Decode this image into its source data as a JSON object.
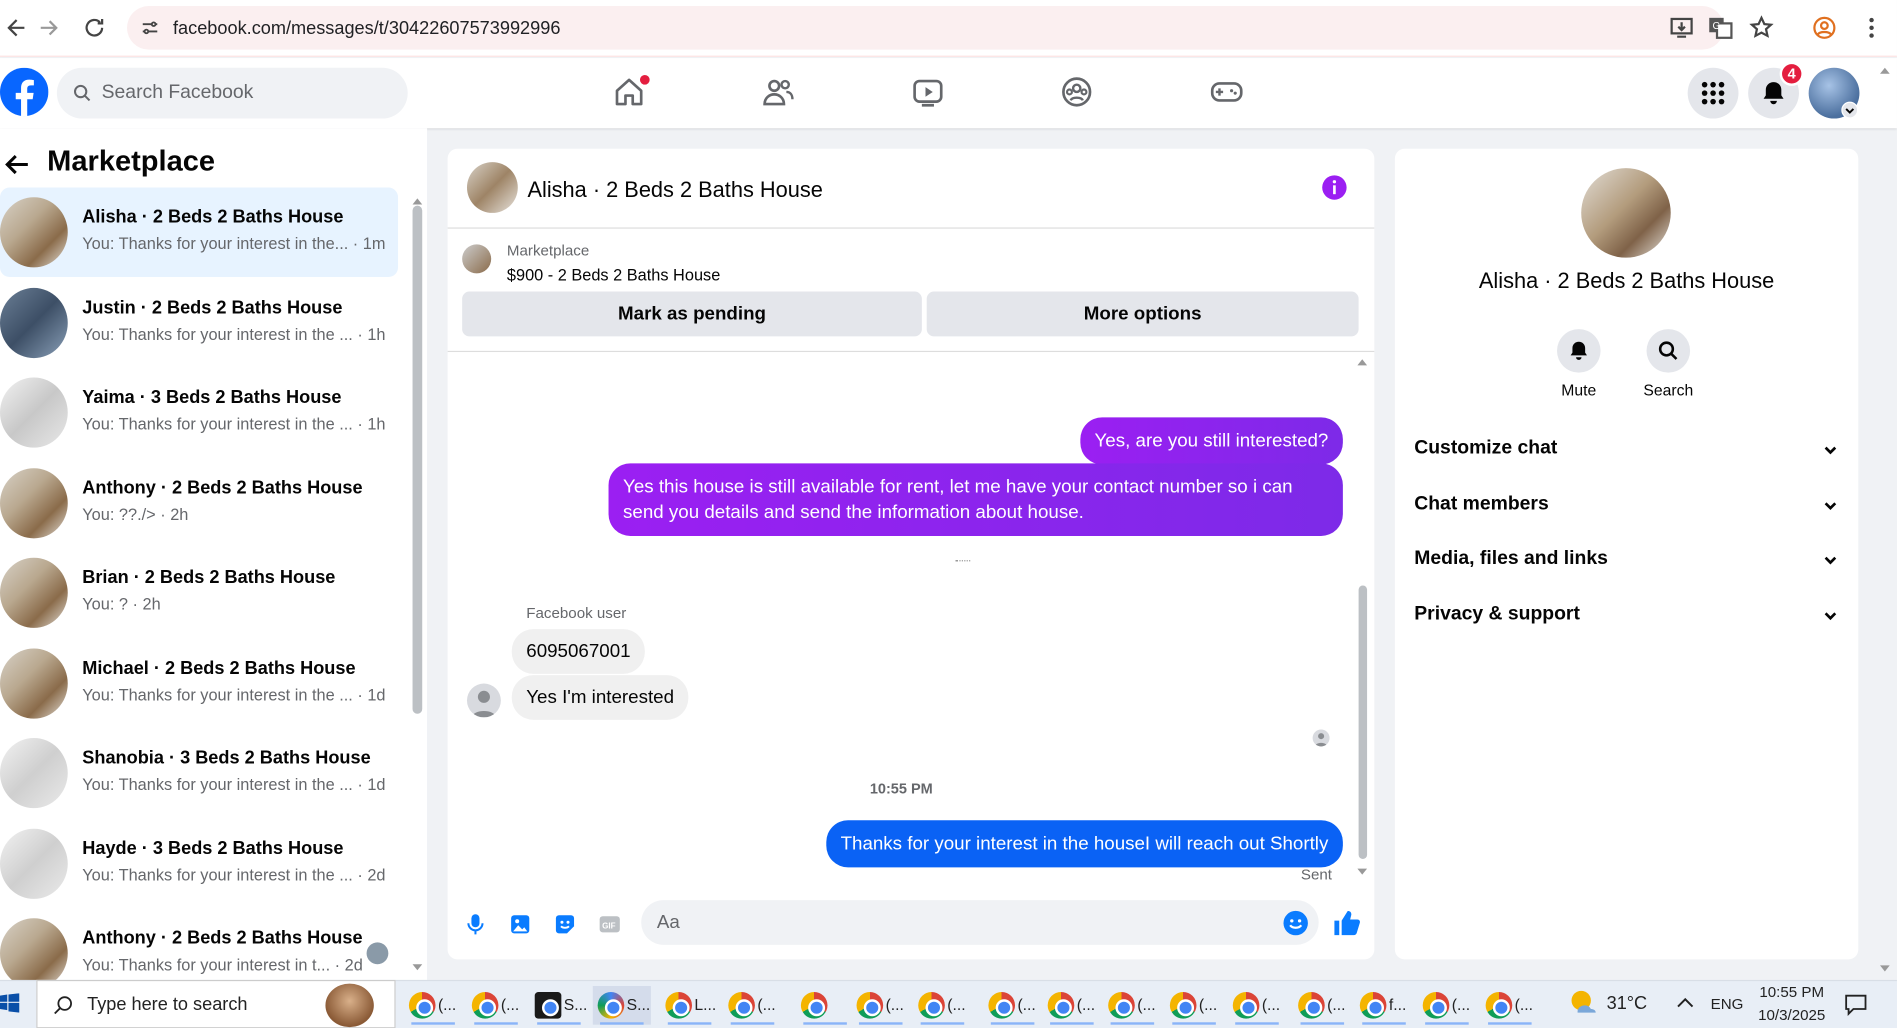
{
  "browser": {
    "url": "facebook.com/messages/t/30422607573992996"
  },
  "header": {
    "search_placeholder": "Search Facebook",
    "notification_count": "4",
    "nav_icons": [
      "home-icon",
      "friends-icon",
      "watch-icon",
      "groups-icon",
      "gaming-icon"
    ]
  },
  "sidebar": {
    "title": "Marketplace",
    "conversations": [
      {
        "name": "Alisha · 2 Beds 2 Baths House",
        "preview": "You: Thanks for your interest in the... · 1m"
      },
      {
        "name": "Justin · 2 Beds 2 Baths House",
        "preview": "You: Thanks for your interest in the ... · 1h"
      },
      {
        "name": "Yaima · 3 Beds 2 Baths House",
        "preview": "You: Thanks for your interest in the ... · 1h"
      },
      {
        "name": "Anthony · 2 Beds 2 Baths House",
        "preview": "You: ??./> · 2h"
      },
      {
        "name": "Brian · 2 Beds 2 Baths House",
        "preview": "You: ? · 2h"
      },
      {
        "name": "Michael · 2 Beds 2 Baths House",
        "preview": "You: Thanks for your interest in the ... · 1d"
      },
      {
        "name": "Shanobia · 3 Beds 2 Baths House",
        "preview": "You: Thanks for your interest in the ... · 1d"
      },
      {
        "name": "Hayde · 3 Beds 2 Baths House",
        "preview": "You: Thanks for your interest in the ... · 2d"
      },
      {
        "name": "Anthony · 2 Beds 2 Baths House",
        "preview": "You: Thanks for your interest in t... · 2d"
      }
    ]
  },
  "chat": {
    "title": "Alisha · 2 Beds 2 Baths House",
    "listing_category": "Marketplace",
    "listing_title": "$900 - 2 Beds 2 Baths House",
    "mark_pending": "Mark as pending",
    "more_options": "More options",
    "msg_out_1": "Yes, are you still interested?",
    "msg_out_2": "Yes this house is still available for rent, let me have your contact number so i can send you details and send the information about house.",
    "sender_label": "Facebook user",
    "msg_in_1": "6095067001",
    "msg_in_2": "Yes I'm interested",
    "time_divider": "10:55 PM",
    "msg_out_3": "Thanks for your interest in the houseI will reach out Shortly",
    "status": "Sent",
    "composer_placeholder": "Aa"
  },
  "details": {
    "name": "Alisha · 2 Beds 2 Baths House",
    "mute": "Mute",
    "search": "Search",
    "sections": [
      "Customize chat",
      "Chat members",
      "Media, files and links",
      "Privacy & support"
    ]
  },
  "taskbar": {
    "search_placeholder": "Type here to search",
    "weather": "31°C",
    "lang": "ENG",
    "time": "10:55 PM",
    "date": "10/3/2025",
    "item_labels": [
      "(...",
      "(...",
      "S...",
      "S...",
      "L...",
      "(...",
      "",
      "(...",
      "(...",
      "(...",
      "(...",
      "(...",
      "(...",
      "(...",
      "(...",
      "f...",
      "(...",
      "(..."
    ]
  },
  "colors": {
    "fb_blue": "#0866ff",
    "messenger_purple": "#8a2be2",
    "messenger_blue": "#0a7cff",
    "badge_red": "#e41e3f"
  }
}
